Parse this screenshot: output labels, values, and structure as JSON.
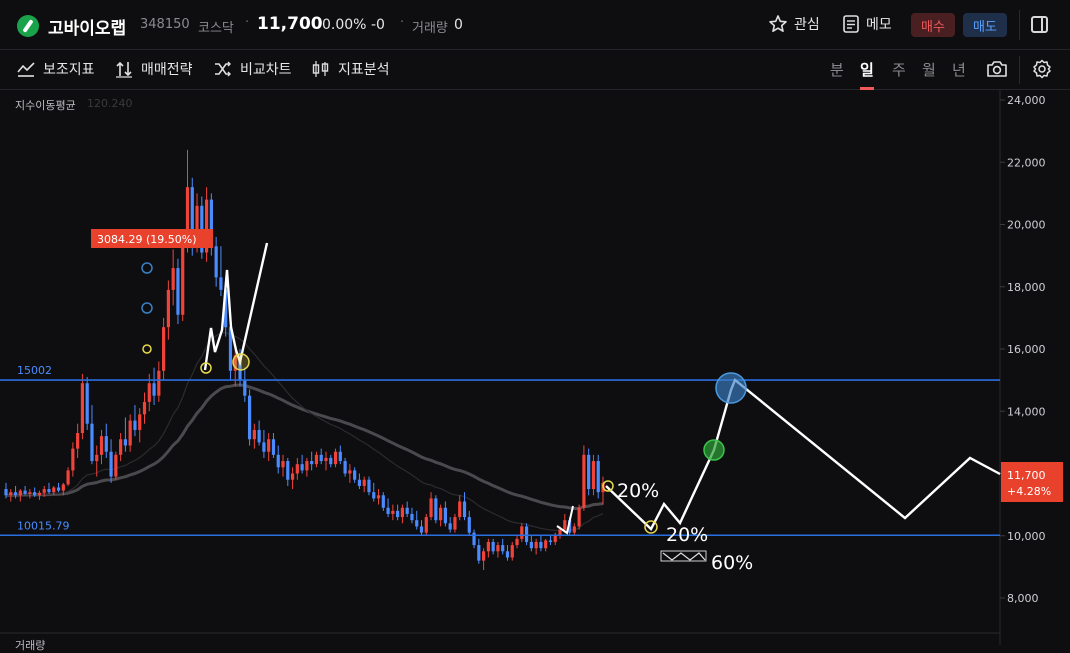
{
  "header": {
    "stock_name": "고바이오랩",
    "stock_code": "348150",
    "market": "코스닥",
    "separator": "·",
    "price": "11,700",
    "change_pct": "0.00%",
    "change_abs": "-0",
    "volume_label": "거래량",
    "volume_value": "0",
    "watch_label": "관심",
    "memo_label": "메모",
    "buy_label": "매수",
    "sell_label": "매도"
  },
  "toolbar": {
    "indicators_label": "보조지표",
    "strategy_label": "매매전략",
    "compare_label": "비교차트",
    "analysis_label": "지표분석",
    "timeframes": [
      "분",
      "일",
      "주",
      "월",
      "년"
    ],
    "active_timeframe": "일"
  },
  "indicator": {
    "label": "지수이동평균",
    "value": "120.240"
  },
  "bottom_label": "거래량",
  "colors": {
    "up": "#f0433a",
    "down": "#4a8cff",
    "level_line": "#2a6fe0",
    "drawing": "#ffffff",
    "yellow_marker": "#e8d84a",
    "blue_circle": "#3a7fc4",
    "green_circle": "#2fa33a"
  },
  "chart_data": {
    "type": "candlestick",
    "ylim": [
      7600,
      24300
    ],
    "y_ticks": [
      "24,000",
      "22,000",
      "20,000",
      "18,000",
      "16,000",
      "14,000",
      "12,000",
      "10,000",
      "8,000"
    ],
    "y_tick_values": [
      24000,
      22000,
      20000,
      18000,
      16000,
      14000,
      12000,
      10000,
      8000
    ],
    "last_price_label": "11,700",
    "last_change_label": "+4.28%",
    "level_lines": [
      {
        "label": "15002",
        "value": 15002
      },
      {
        "label": "10015.79",
        "value": 10015.79
      }
    ],
    "callout": {
      "text": "3084.29 (19.50%)",
      "value": 20000
    },
    "annotations": [
      {
        "text": "20%"
      },
      {
        "text": "20%"
      },
      {
        "text": "60%"
      }
    ],
    "candles_ohlc": [
      [
        11500,
        11700,
        11200,
        11300
      ],
      [
        11300,
        11500,
        11100,
        11400
      ],
      [
        11400,
        11600,
        11200,
        11300
      ],
      [
        11300,
        11500,
        11100,
        11450
      ],
      [
        11450,
        11600,
        11300,
        11350
      ],
      [
        11350,
        11500,
        11200,
        11400
      ],
      [
        11400,
        11550,
        11250,
        11300
      ],
      [
        11300,
        11450,
        11150,
        11380
      ],
      [
        11380,
        11600,
        11250,
        11500
      ],
      [
        11500,
        11700,
        11350,
        11400
      ],
      [
        11400,
        11600,
        11300,
        11550
      ],
      [
        11550,
        11700,
        11400,
        11450
      ],
      [
        11450,
        11700,
        11300,
        11650
      ],
      [
        11650,
        12200,
        11600,
        12100
      ],
      [
        12100,
        13000,
        11900,
        12800
      ],
      [
        12800,
        13600,
        12500,
        13300
      ],
      [
        13300,
        15200,
        13100,
        14900
      ],
      [
        14900,
        15100,
        13400,
        13600
      ],
      [
        13600,
        14200,
        12300,
        12400
      ],
      [
        12400,
        12900,
        11900,
        12600
      ],
      [
        12600,
        13400,
        12300,
        13200
      ],
      [
        13200,
        13600,
        12500,
        12700
      ],
      [
        12700,
        13100,
        11700,
        11900
      ],
      [
        11900,
        12700,
        11800,
        12600
      ],
      [
        12600,
        13300,
        12400,
        13100
      ],
      [
        13100,
        13800,
        12700,
        12900
      ],
      [
        12900,
        13900,
        12700,
        13700
      ],
      [
        13700,
        14200,
        13200,
        13400
      ],
      [
        13400,
        14100,
        13000,
        13900
      ],
      [
        13900,
        14600,
        13600,
        14300
      ],
      [
        14300,
        15200,
        14000,
        14900
      ],
      [
        14900,
        15400,
        14200,
        14500
      ],
      [
        14500,
        15600,
        14300,
        15300
      ],
      [
        15300,
        17000,
        15000,
        16700
      ],
      [
        16700,
        18200,
        16300,
        17900
      ],
      [
        17900,
        19200,
        17400,
        18600
      ],
      [
        18600,
        18900,
        16800,
        17100
      ],
      [
        17100,
        19800,
        16900,
        19500
      ],
      [
        19500,
        22400,
        19100,
        21200
      ],
      [
        21200,
        21500,
        19000,
        19400
      ],
      [
        19400,
        21000,
        19100,
        20600
      ],
      [
        20600,
        20900,
        18900,
        19100
      ],
      [
        19100,
        21200,
        18800,
        20800
      ],
      [
        20800,
        21000,
        19000,
        19300
      ],
      [
        19300,
        19600,
        18000,
        18300
      ],
      [
        18300,
        19300,
        17700,
        17900
      ],
      [
        17900,
        18300,
        16400,
        16700
      ],
      [
        16700,
        17100,
        15000,
        15300
      ],
      [
        15300,
        16100,
        14800,
        15800
      ],
      [
        15800,
        16000,
        14800,
        15000
      ],
      [
        15000,
        15400,
        14300,
        14500
      ],
      [
        14500,
        14700,
        12900,
        13100
      ],
      [
        13100,
        13600,
        12800,
        13400
      ],
      [
        13400,
        13700,
        12900,
        13000
      ],
      [
        13000,
        13400,
        12500,
        12700
      ],
      [
        12700,
        13300,
        12400,
        13100
      ],
      [
        13100,
        13300,
        12500,
        12600
      ],
      [
        12600,
        12900,
        12000,
        12200
      ],
      [
        12200,
        12600,
        11900,
        12400
      ],
      [
        12400,
        12500,
        11600,
        11800
      ],
      [
        11800,
        12200,
        11500,
        12000
      ],
      [
        12000,
        12500,
        11800,
        12300
      ],
      [
        12300,
        12600,
        12000,
        12100
      ],
      [
        12100,
        12500,
        11900,
        12400
      ],
      [
        12400,
        12700,
        12100,
        12300
      ],
      [
        12300,
        12700,
        12200,
        12600
      ],
      [
        12600,
        12800,
        12300,
        12400
      ],
      [
        12400,
        12700,
        12100,
        12500
      ],
      [
        12500,
        12600,
        12200,
        12300
      ],
      [
        12300,
        12800,
        12200,
        12700
      ],
      [
        12700,
        12900,
        12300,
        12400
      ],
      [
        12400,
        12500,
        11900,
        12000
      ],
      [
        12000,
        12300,
        11700,
        12100
      ],
      [
        12100,
        12200,
        11700,
        11800
      ],
      [
        11800,
        12000,
        11500,
        11600
      ],
      [
        11600,
        11900,
        11400,
        11800
      ],
      [
        11800,
        11900,
        11300,
        11400
      ],
      [
        11400,
        11700,
        11100,
        11200
      ],
      [
        11200,
        11500,
        11000,
        11300
      ],
      [
        11300,
        11400,
        10800,
        10900
      ],
      [
        10900,
        11200,
        10600,
        10700
      ],
      [
        10700,
        11000,
        10500,
        10800
      ],
      [
        10800,
        11000,
        10500,
        10600
      ],
      [
        10600,
        11000,
        10400,
        10900
      ],
      [
        10900,
        11100,
        10600,
        10700
      ],
      [
        10700,
        10900,
        10400,
        10500
      ],
      [
        10500,
        10800,
        10200,
        10300
      ],
      [
        10300,
        10500,
        10000,
        10100
      ],
      [
        10100,
        10700,
        10000,
        10600
      ],
      [
        10600,
        11400,
        10500,
        11200
      ],
      [
        11200,
        11300,
        10400,
        10500
      ],
      [
        10500,
        11000,
        10300,
        10900
      ],
      [
        10900,
        11100,
        10300,
        10400
      ],
      [
        10400,
        10600,
        10100,
        10200
      ],
      [
        10200,
        10700,
        10100,
        10600
      ],
      [
        10600,
        11300,
        10500,
        11100
      ],
      [
        11100,
        11400,
        10500,
        10600
      ],
      [
        10600,
        10800,
        10000,
        10100
      ],
      [
        10100,
        10200,
        9600,
        9700
      ],
      [
        9700,
        9900,
        9100,
        9200
      ],
      [
        9200,
        9600,
        8900,
        9500
      ],
      [
        9500,
        9900,
        9300,
        9800
      ],
      [
        9800,
        9900,
        9400,
        9500
      ],
      [
        9500,
        9800,
        9300,
        9700
      ],
      [
        9700,
        9900,
        9400,
        9500
      ],
      [
        9500,
        9700,
        9200,
        9300
      ],
      [
        9300,
        9800,
        9200,
        9700
      ],
      [
        9700,
        10000,
        9600,
        9900
      ],
      [
        9900,
        10400,
        9800,
        10300
      ],
      [
        10300,
        10400,
        9700,
        9800
      ],
      [
        9800,
        10000,
        9500,
        9600
      ],
      [
        9600,
        9900,
        9400,
        9800
      ],
      [
        9800,
        10000,
        9500,
        9600
      ],
      [
        9600,
        9900,
        9500,
        9850
      ],
      [
        9850,
        10000,
        9700,
        9800
      ],
      [
        9800,
        10100,
        9700,
        10000
      ],
      [
        10000,
        10300,
        9900,
        10200
      ],
      [
        10200,
        10700,
        10100,
        10500
      ],
      [
        10500,
        10600,
        10000,
        10100
      ],
      [
        10100,
        10400,
        10000,
        10300
      ],
      [
        10300,
        11000,
        10200,
        10900
      ],
      [
        10900,
        12900,
        10800,
        12600
      ],
      [
        12600,
        12800,
        11300,
        11500
      ],
      [
        11500,
        12600,
        11300,
        12400
      ],
      [
        12400,
        12600,
        11200,
        11400
      ],
      [
        11400,
        11900,
        11000,
        11700
      ]
    ]
  }
}
